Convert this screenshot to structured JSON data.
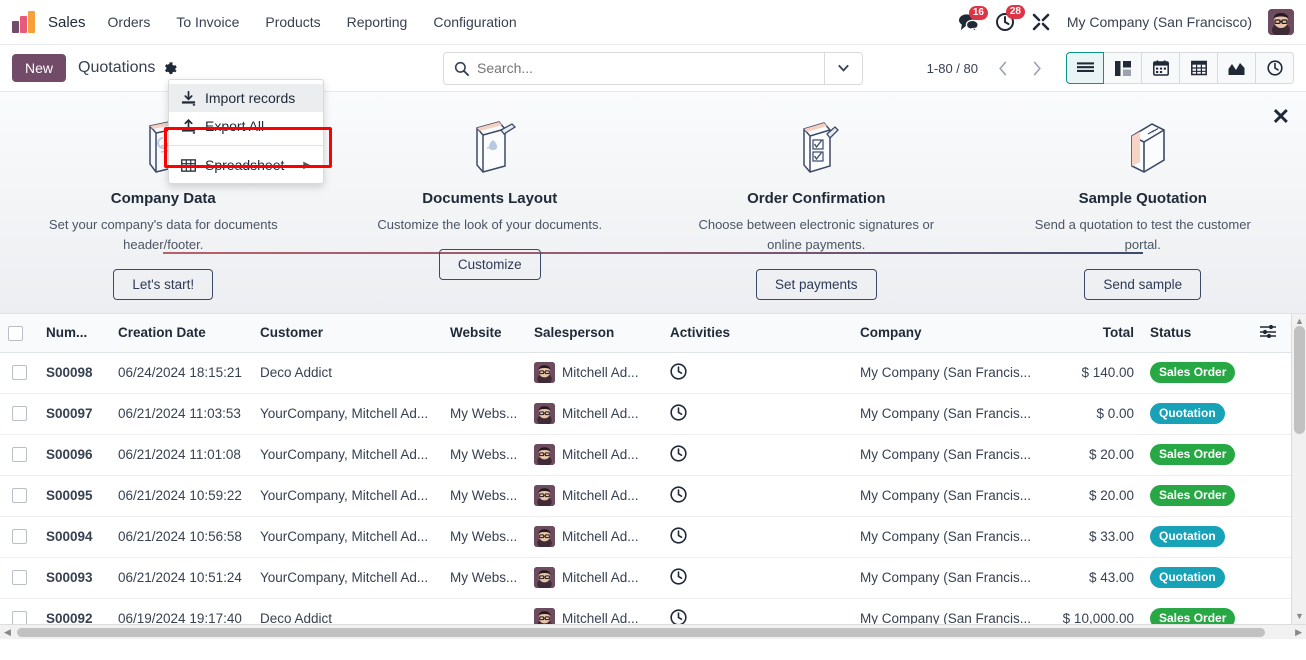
{
  "navbar": {
    "app_name": "Sales",
    "menu_items": [
      {
        "label": "Orders"
      },
      {
        "label": "To Invoice"
      },
      {
        "label": "Products"
      },
      {
        "label": "Reporting"
      },
      {
        "label": "Configuration"
      }
    ],
    "messages_badge": "16",
    "activities_badge": "28",
    "company": "My Company (San Francisco)",
    "logo_colors": [
      "#714B67",
      "#E8597A",
      "#F4A13C"
    ]
  },
  "control_panel": {
    "new_label": "New",
    "breadcrumb": "Quotations",
    "pager": "1-80 / 80",
    "views": [
      {
        "name": "list",
        "active": true
      },
      {
        "name": "kanban",
        "active": false
      },
      {
        "name": "calendar",
        "active": false
      },
      {
        "name": "pivot",
        "active": false
      },
      {
        "name": "graph",
        "active": false
      },
      {
        "name": "activity",
        "active": false
      }
    ]
  },
  "search": {
    "placeholder": "Search...",
    "value": ""
  },
  "dropdown": {
    "items": [
      {
        "label": "Import records",
        "icon": "import-icon",
        "highlighted": true
      },
      {
        "label": "Export All",
        "icon": "export-icon",
        "highlighted": false
      },
      {
        "label": "Spreadsheet",
        "icon": "spreadsheet-icon",
        "highlighted": false,
        "submenu": true
      }
    ]
  },
  "onboarding": {
    "close_label": "✕",
    "cards": [
      {
        "title": "Company Data",
        "description": "Set your company's data for documents header/footer.",
        "button": "Let's start!",
        "icon": "company-data-icon"
      },
      {
        "title": "Documents Layout",
        "description": "Customize the look of your documents.",
        "button": "Customize",
        "icon": "documents-layout-icon"
      },
      {
        "title": "Order Confirmation",
        "description": "Choose between electronic signatures or online payments.",
        "button": "Set payments",
        "icon": "order-confirmation-icon"
      },
      {
        "title": "Sample Quotation",
        "description": "Send a quotation to test the customer portal.",
        "button": "Send sample",
        "icon": "sample-quotation-icon"
      }
    ]
  },
  "table": {
    "headers": {
      "number": "Num...",
      "creation_date": "Creation Date",
      "customer": "Customer",
      "website": "Website",
      "salesperson": "Salesperson",
      "activities": "Activities",
      "company": "Company",
      "total": "Total",
      "status": "Status"
    },
    "rows": [
      {
        "number": "S00098",
        "creation_date": "06/24/2024 18:15:21",
        "customer": "Deco Addict",
        "website": "",
        "salesperson": "Mitchell Ad...",
        "company": "My Company (San Francis...",
        "total": "$ 140.00",
        "status": "Sales Order",
        "status_type": "sales"
      },
      {
        "number": "S00097",
        "creation_date": "06/21/2024 11:03:53",
        "customer": "YourCompany, Mitchell Ad...",
        "website": "My Webs...",
        "salesperson": "Mitchell Ad...",
        "company": "My Company (San Francis...",
        "total": "$ 0.00",
        "status": "Quotation",
        "status_type": "quote"
      },
      {
        "number": "S00096",
        "creation_date": "06/21/2024 11:01:08",
        "customer": "YourCompany, Mitchell Ad...",
        "website": "My Webs...",
        "salesperson": "Mitchell Ad...",
        "company": "My Company (San Francis...",
        "total": "$ 20.00",
        "status": "Sales Order",
        "status_type": "sales"
      },
      {
        "number": "S00095",
        "creation_date": "06/21/2024 10:59:22",
        "customer": "YourCompany, Mitchell Ad...",
        "website": "My Webs...",
        "salesperson": "Mitchell Ad...",
        "company": "My Company (San Francis...",
        "total": "$ 20.00",
        "status": "Sales Order",
        "status_type": "sales"
      },
      {
        "number": "S00094",
        "creation_date": "06/21/2024 10:56:58",
        "customer": "YourCompany, Mitchell Ad...",
        "website": "My Webs...",
        "salesperson": "Mitchell Ad...",
        "company": "My Company (San Francis...",
        "total": "$ 33.00",
        "status": "Quotation",
        "status_type": "quote"
      },
      {
        "number": "S00093",
        "creation_date": "06/21/2024 10:51:24",
        "customer": "YourCompany, Mitchell Ad...",
        "website": "My Webs...",
        "salesperson": "Mitchell Ad...",
        "company": "My Company (San Francis...",
        "total": "$ 43.00",
        "status": "Quotation",
        "status_type": "quote"
      },
      {
        "number": "S00092",
        "creation_date": "06/19/2024 19:17:40",
        "customer": "Deco Addict",
        "website": "",
        "salesperson": "Mitchell Ad...",
        "company": "My Company (San Francis...",
        "total": "$ 10,000.00",
        "status": "Sales Order",
        "status_type": "sales"
      }
    ]
  },
  "colors": {
    "primary": "#714B67",
    "sales_order_badge": "#28a745",
    "quotation_badge": "#17a2b8",
    "highlight_outline": "#ff0000"
  }
}
